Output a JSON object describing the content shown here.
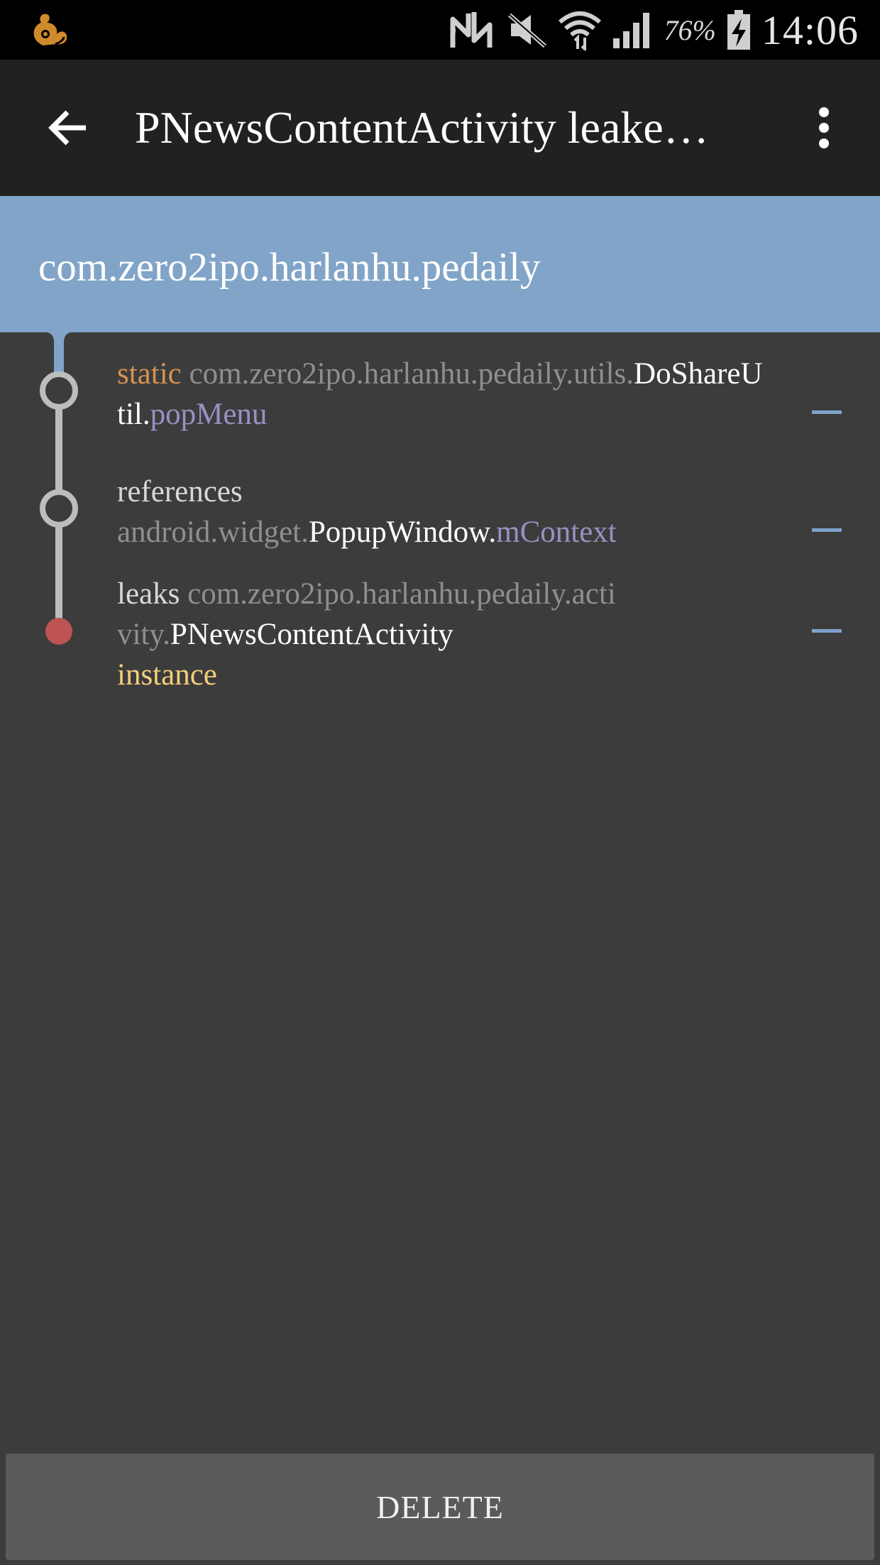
{
  "status_bar": {
    "battery_percent": "76%",
    "time": "14:06",
    "icons": [
      "uc-browser-icon",
      "nfc-icon",
      "mute-icon",
      "wifi-icon",
      "signal-icon",
      "battery-charging-icon"
    ]
  },
  "app_bar": {
    "title": "PNewsContentActivity leake…",
    "back_icon": "arrow-back-icon",
    "menu_icon": "more-vert-icon"
  },
  "package": {
    "name": "com.zero2ipo.harlanhu.pedaily"
  },
  "trace": [
    {
      "prefix": "static",
      "package": "com.zero2ipo.harlanhu.pedaily.utils.",
      "class_name": "DoShareUtil.",
      "field": "popMenu",
      "node": "hollow"
    },
    {
      "prefix": "references",
      "package": "android.widget.",
      "class_name": "PopupWindow.",
      "field": "mContext",
      "node": "hollow"
    },
    {
      "prefix": "leaks",
      "package": "com.zero2ipo.harlanhu.pedaily.activity.",
      "class_name": "PNewsContentActivity",
      "suffix": "instance",
      "node": "leak"
    }
  ],
  "actions": {
    "delete_label": "DELETE"
  },
  "colors": {
    "status_bar": "#000000",
    "app_bar": "#212121",
    "package_header": "#81a4c8",
    "background": "#3c3c3c",
    "static_keyword": "#d6924f",
    "field": "#9b8fc2",
    "instance_keyword": "#f3cf7a",
    "leak_node": "#bd5353",
    "collapse_dash": "#7ea2cc",
    "delete_button": "#5a5a5c"
  }
}
